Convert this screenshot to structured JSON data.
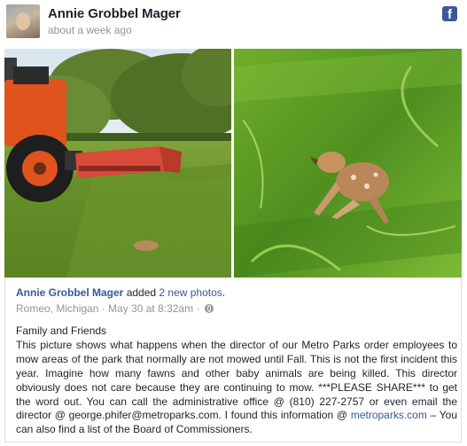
{
  "post": {
    "author": "Annie Grobbel Mager",
    "time": "about a week ago",
    "brand_icon": "facebook-icon",
    "brand_glyph": "f"
  },
  "shared": {
    "author": "Annie Grobbel Mager",
    "action": " added ",
    "photos_link": "2 new photos",
    "period": ".",
    "location": "Romeo, Michigan",
    "separator": " · ",
    "date": "May 30 at 8:32am",
    "privacy_separator": " · ",
    "privacy_icon": "globe-icon"
  },
  "body": {
    "heading": "Family and Friends",
    "text_before_link": "This picture shows what happens when the director of our Metro Parks order employees to mow areas of the park that normally are not mowed until Fall. This is not the first incident this year. Imagine how many fawns and other baby animals are being killed. This director obviously does not care because they are continuing to mow. ***PLEASE SHARE*** to get the word out. You can call the administrative office @ (810) 227-2757 or even email the director @ george.phifer@metroparks.com. I found this information @ ",
    "link_text": "metroparks.com",
    "text_after_link": " – You can also find a list of the Board of Commissioners."
  },
  "colors": {
    "facebook_blue": "#3b5998",
    "link_blue": "#365899",
    "meta_gray": "#90949c",
    "tractor_orange": "#e0531d"
  }
}
